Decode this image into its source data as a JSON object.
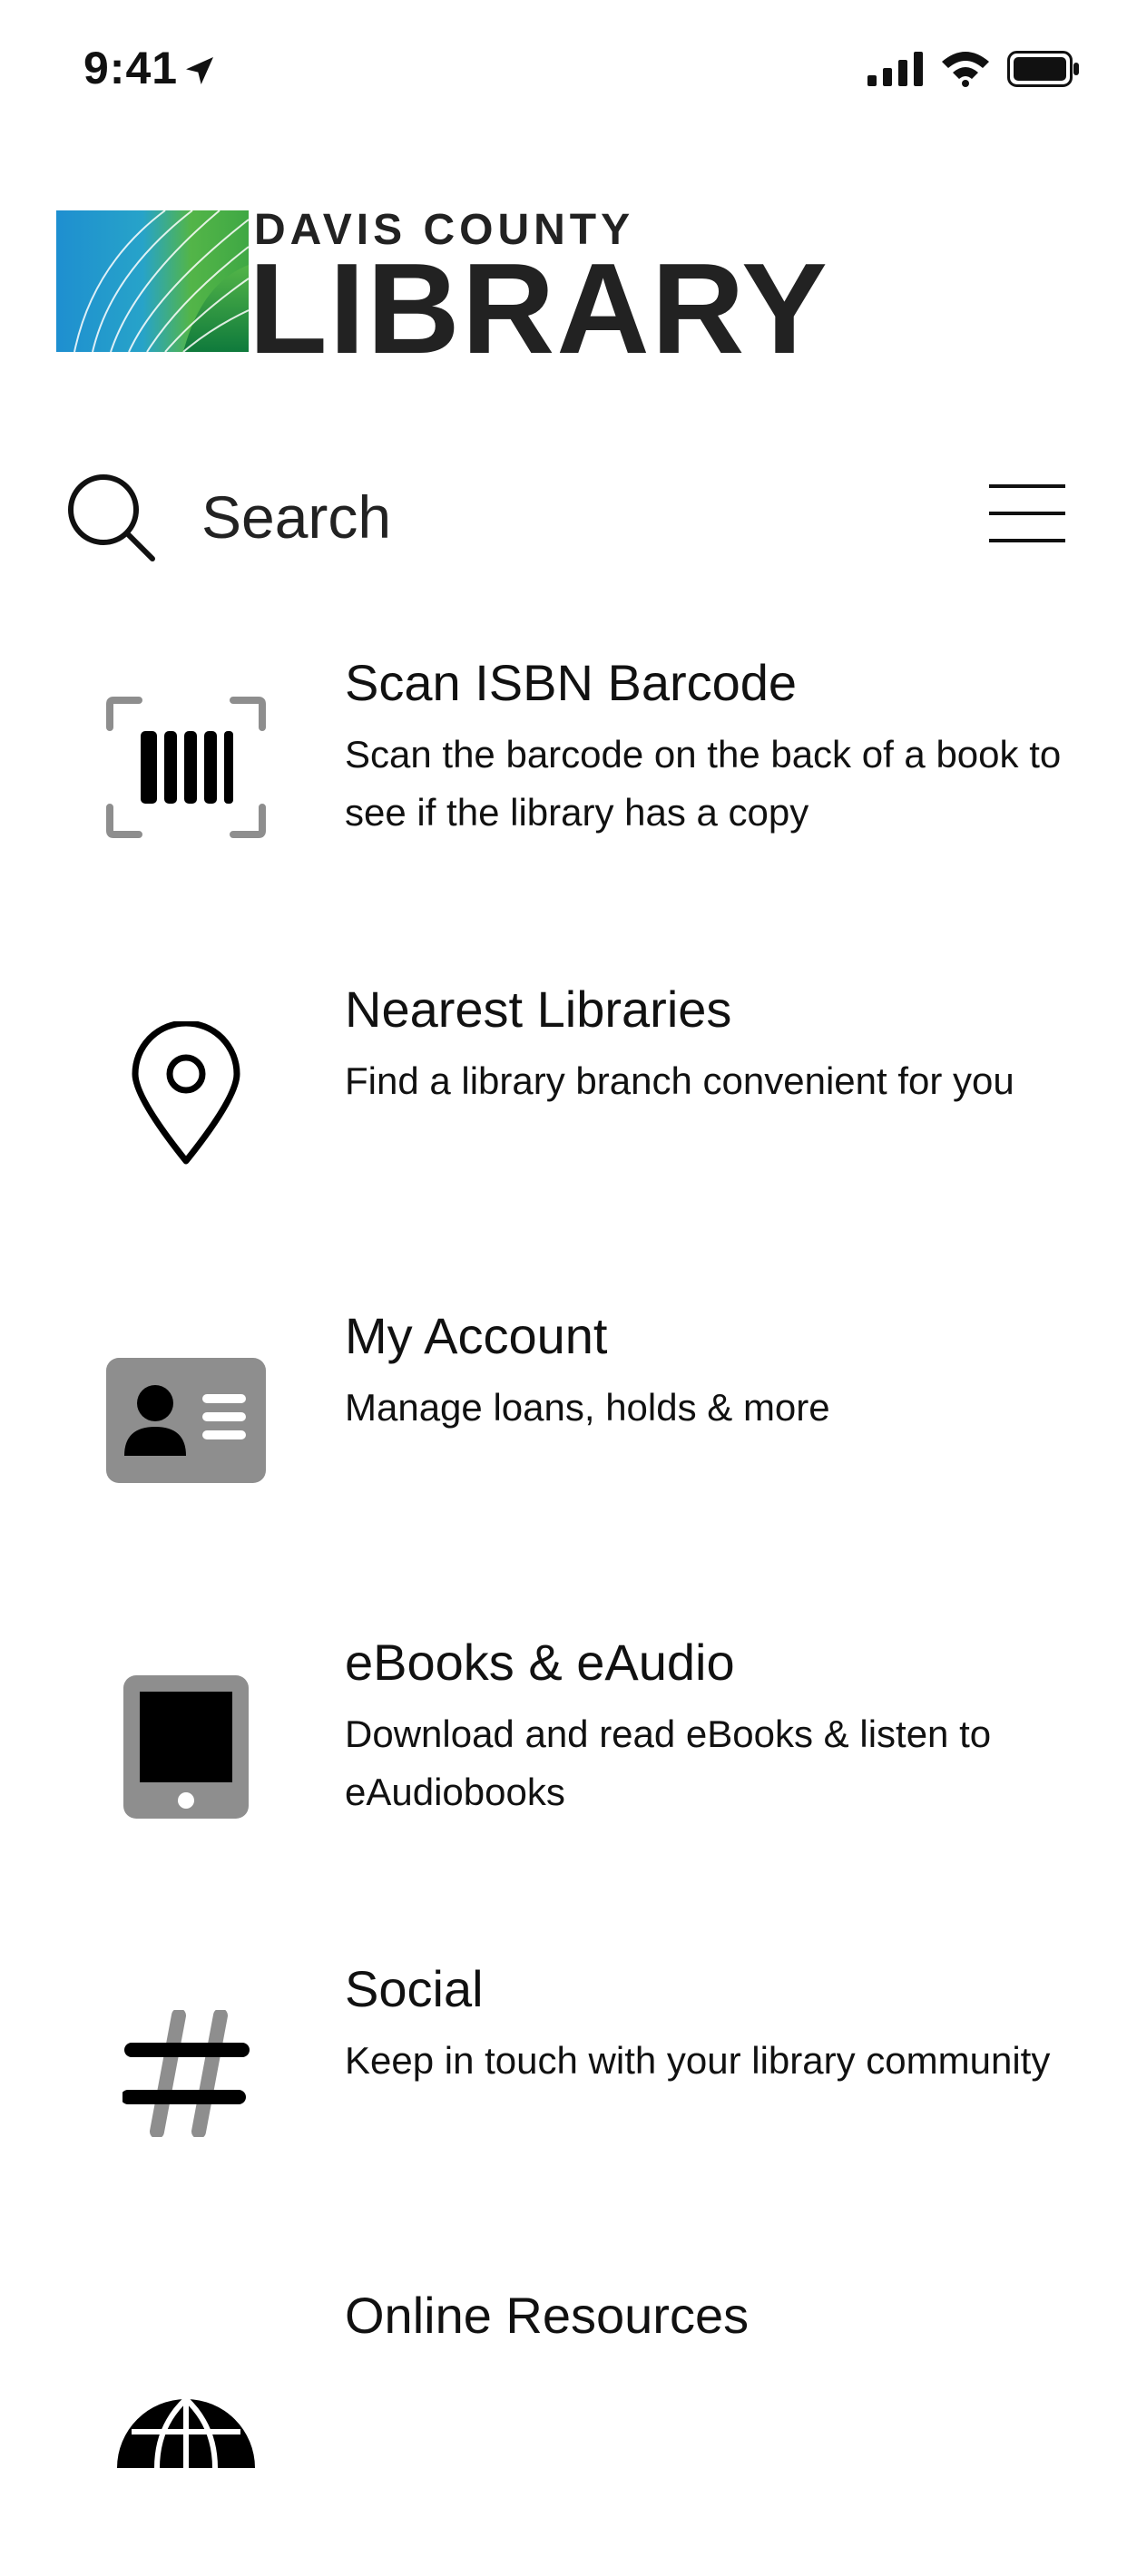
{
  "status_bar": {
    "time": "9:41"
  },
  "logo": {
    "top_text": "DAVIS COUNTY",
    "main_text": "LIBRARY"
  },
  "search": {
    "placeholder": "Search"
  },
  "menu_items": [
    {
      "title": "Scan ISBN Barcode",
      "description": "Scan the barcode on the back of a book to see if the library has a copy",
      "icon": "barcode-scan-icon"
    },
    {
      "title": "Nearest Libraries",
      "description": "Find a library branch convenient for you",
      "icon": "location-pin-icon"
    },
    {
      "title": "My Account",
      "description": "Manage loans, holds & more",
      "icon": "account-card-icon"
    },
    {
      "title": "eBooks & eAudio",
      "description": "Download and read eBooks & listen to eAudiobooks",
      "icon": "tablet-icon"
    },
    {
      "title": "Social",
      "description": "Keep in touch with your library community",
      "icon": "hashtag-icon"
    },
    {
      "title": "Online Resources",
      "description": "",
      "icon": "globe-icon"
    }
  ],
  "colors": {
    "text": "#111111",
    "icon_gray": "#8e8e8e",
    "logo_blue": "#1f8fd1",
    "logo_green": "#5bb545",
    "logo_dark_green": "#0f7a3c"
  }
}
